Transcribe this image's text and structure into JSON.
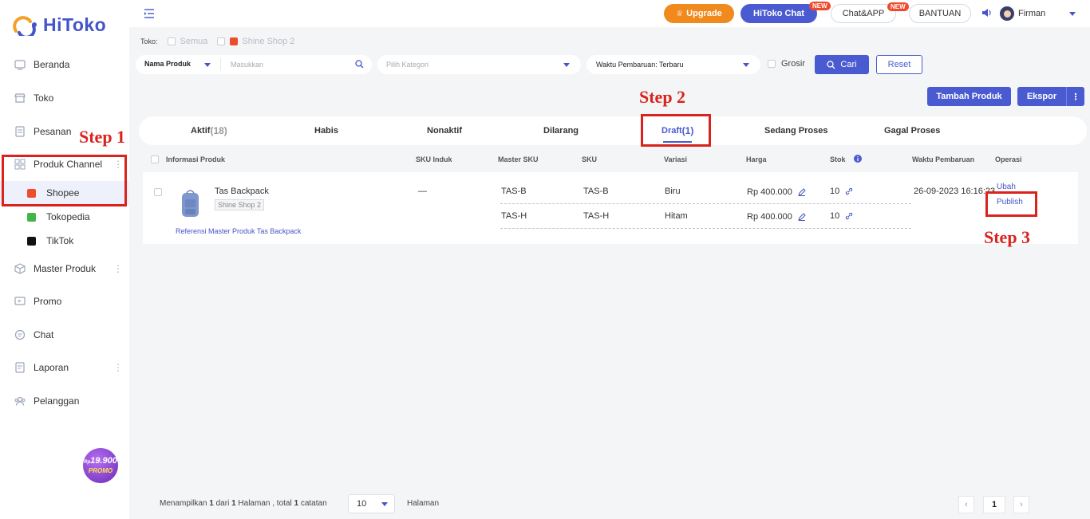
{
  "app": {
    "name": "HiToko"
  },
  "sidebar": {
    "items": [
      {
        "label": "Beranda",
        "icon": "home-icon"
      },
      {
        "label": "Toko",
        "icon": "store-icon"
      },
      {
        "label": "Pesanan",
        "icon": "orders-icon"
      },
      {
        "label": "Produk Channel",
        "icon": "grid-icon"
      },
      {
        "label": "Master Produk",
        "icon": "cube-icon"
      },
      {
        "label": "Promo",
        "icon": "promo-icon"
      },
      {
        "label": "Chat",
        "icon": "chat-icon"
      },
      {
        "label": "Laporan",
        "icon": "report-icon"
      },
      {
        "label": "Pelanggan",
        "icon": "customers-icon"
      }
    ],
    "channels": [
      {
        "label": "Shopee",
        "color": "#ee4d2d"
      },
      {
        "label": "Tokopedia",
        "color": "#42b549"
      },
      {
        "label": "TikTok",
        "color": "#111111"
      }
    ],
    "promo_badge": {
      "price": "19.900",
      "currency": "Rp",
      "label": "PROMO"
    }
  },
  "topbar": {
    "upgrade": "Upgrade",
    "hitoko_chat": "HiToko Chat",
    "chat_app": "Chat&APP",
    "bantuan": "BANTUAN",
    "new_tag": "NEW",
    "user_name": "Firman"
  },
  "filters": {
    "store_label": "Toko:",
    "store_all": "Semua",
    "store_name": "Shine Shop 2",
    "search_type": "Nama Produk",
    "search_placeholder": "Masukkan",
    "category_placeholder": "Pilih Kategori",
    "sort_value": "Waktu Pembaruan: Terbaru",
    "grosir": "Grosir",
    "cari": "Cari",
    "reset": "Reset"
  },
  "actions": {
    "tambah": "Tambah Produk",
    "ekspor": "Ekspor"
  },
  "tabs": [
    {
      "label": "Aktif",
      "count": "(18)"
    },
    {
      "label": "Habis",
      "count": ""
    },
    {
      "label": "Nonaktif",
      "count": ""
    },
    {
      "label": "Dilarang",
      "count": ""
    },
    {
      "label": "Draft",
      "count": "(1)"
    },
    {
      "label": "Sedang Proses",
      "count": ""
    },
    {
      "label": "Gagal Proses",
      "count": ""
    }
  ],
  "table": {
    "headers": [
      "Informasi Produk",
      "SKU Induk",
      "Master SKU",
      "SKU",
      "Variasi",
      "Harga",
      "Stok",
      "Waktu Pembaruan",
      "Operasi"
    ],
    "product": {
      "name": "Tas Backpack",
      "shop": "Shine Shop 2",
      "sku_induk": "—",
      "reference": "Referensi Master Produk Tas Backpack",
      "updated": "26-09-2023 16:16:23",
      "variants": [
        {
          "master_sku": "TAS-B",
          "sku": "TAS-B",
          "variation": "Biru",
          "price": "Rp 400.000",
          "stock": "10"
        },
        {
          "master_sku": "TAS-H",
          "sku": "TAS-H",
          "variation": "Hitam",
          "price": "Rp 400.000",
          "stock": "10"
        }
      ],
      "ops": {
        "edit": "Ubah",
        "publish": "Publish"
      }
    }
  },
  "annotations": {
    "step1": "Step 1",
    "step2": "Step 2",
    "step3": "Step 3"
  },
  "footer": {
    "prefix": "Menampilkan",
    "page_current": "1",
    "of": "dari",
    "page_total": "1",
    "halaman_word": "Halaman",
    "total_word": ", total",
    "records": "1",
    "records_word": "catatan",
    "page_size": "10",
    "halaman": "Halaman",
    "page": "1"
  }
}
